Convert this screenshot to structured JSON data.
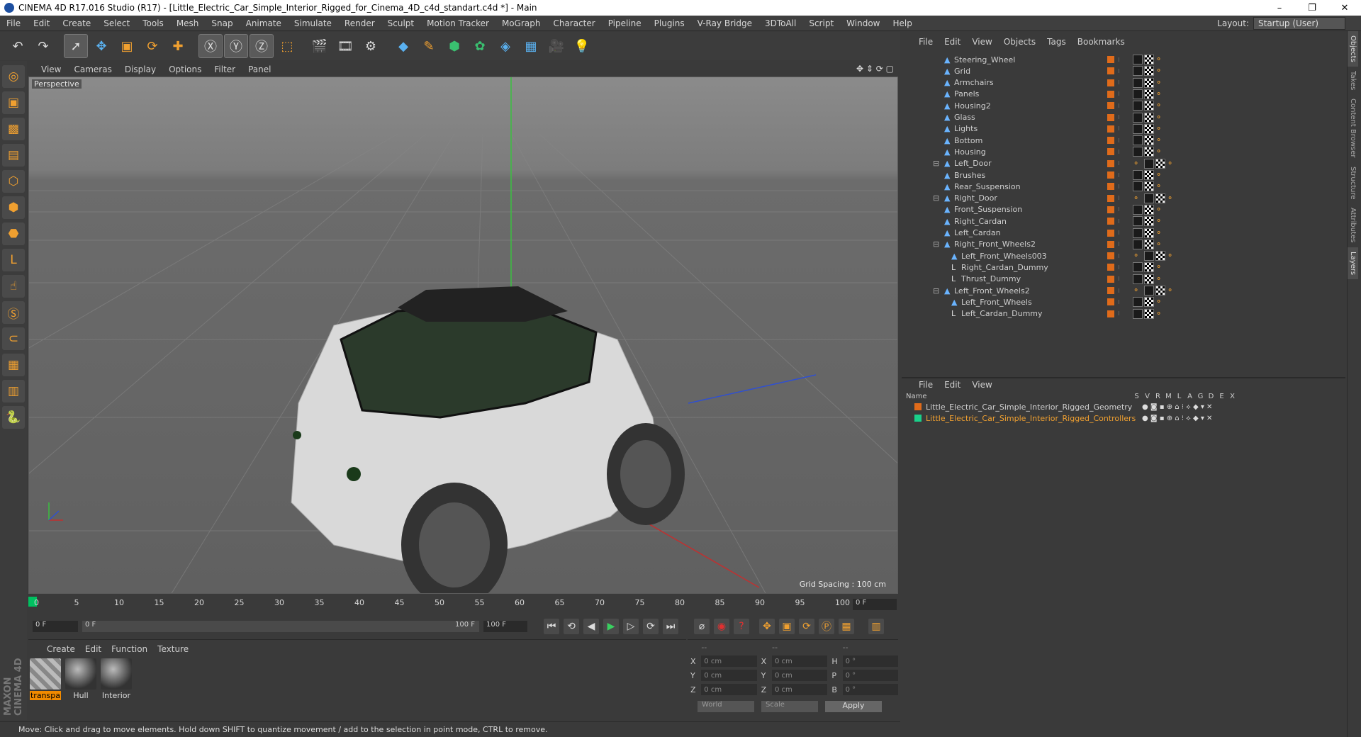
{
  "window": {
    "title": "CINEMA 4D R17.016 Studio (R17) - [Little_Electric_Car_Simple_Interior_Rigged_for_Cinema_4D_c4d_standart.c4d *] - Main",
    "controls": [
      "–",
      "❐",
      "✕"
    ]
  },
  "menubar": [
    "File",
    "Edit",
    "Create",
    "Select",
    "Tools",
    "Mesh",
    "Snap",
    "Animate",
    "Simulate",
    "Render",
    "Sculpt",
    "Motion Tracker",
    "MoGraph",
    "Character",
    "Pipeline",
    "Plugins",
    "V-Ray Bridge",
    "3DToAll",
    "Script",
    "Window",
    "Help"
  ],
  "layout": {
    "label": "Layout:",
    "value": "Startup (User)"
  },
  "viewport": {
    "menu": [
      "View",
      "Cameras",
      "Display",
      "Options",
      "Filter",
      "Panel"
    ],
    "label": "Perspective",
    "grid_spacing": "Grid Spacing : 100 cm"
  },
  "timeline": {
    "ticks": [
      "0",
      "5",
      "10",
      "15",
      "20",
      "25",
      "30",
      "35",
      "40",
      "45",
      "50",
      "55",
      "60",
      "65",
      "70",
      "75",
      "80",
      "85",
      "90",
      "95",
      "100"
    ],
    "current": "0 F"
  },
  "transport": {
    "start": "0 F",
    "range_start": "0 F",
    "range_end": "100 F",
    "end": "100 F"
  },
  "materials": {
    "menu": [
      "Create",
      "Edit",
      "Function",
      "Texture"
    ],
    "items": [
      {
        "name": "transpa",
        "highlight": true
      },
      {
        "name": "Hull",
        "highlight": false
      },
      {
        "name": "Interior",
        "highlight": false
      }
    ]
  },
  "coords": {
    "headers": [
      "--",
      "--",
      "--"
    ],
    "rows": [
      {
        "a": "X",
        "av": "0 cm",
        "b": "X",
        "bv": "0 cm",
        "c": "H",
        "cv": "0 °"
      },
      {
        "a": "Y",
        "av": "0 cm",
        "b": "Y",
        "bv": "0 cm",
        "c": "P",
        "cv": "0 °"
      },
      {
        "a": "Z",
        "av": "0 cm",
        "b": "Z",
        "bv": "0 cm",
        "c": "B",
        "cv": "0 °"
      }
    ],
    "world": "World",
    "scale": "Scale",
    "apply": "Apply"
  },
  "status": "Move: Click and drag to move elements. Hold down SHIFT to quantize movement / add to the selection in point mode, CTRL to remove.",
  "object_manager": {
    "menu": [
      "File",
      "Edit",
      "View",
      "Objects",
      "Tags",
      "Bookmarks"
    ],
    "objects": [
      {
        "name": "Steering_Wheel",
        "depth": 0
      },
      {
        "name": "Grid",
        "depth": 0
      },
      {
        "name": "Armchairs",
        "depth": 0
      },
      {
        "name": "Panels",
        "depth": 0
      },
      {
        "name": "Housing2",
        "depth": 0
      },
      {
        "name": "Glass",
        "depth": 0
      },
      {
        "name": "Lights",
        "depth": 0
      },
      {
        "name": "Bottom",
        "depth": 0
      },
      {
        "name": "Housing",
        "depth": 0
      },
      {
        "name": "Left_Door",
        "depth": 0
      },
      {
        "name": "Brushes",
        "depth": 0
      },
      {
        "name": "Rear_Suspension",
        "depth": 0
      },
      {
        "name": "Right_Door",
        "depth": 0
      },
      {
        "name": "Front_Suspension",
        "depth": 0
      },
      {
        "name": "Right_Cardan",
        "depth": 0
      },
      {
        "name": "Left_Cardan",
        "depth": 0
      },
      {
        "name": "Right_Front_Wheels2",
        "depth": 0
      },
      {
        "name": "Left_Front_Wheels003",
        "depth": 1
      },
      {
        "name": "Right_Cardan_Dummy",
        "depth": 1
      },
      {
        "name": "Thrust_Dummy",
        "depth": 1
      },
      {
        "name": "Left_Front_Wheels2",
        "depth": 0
      },
      {
        "name": "Left_Front_Wheels",
        "depth": 1
      },
      {
        "name": "Left_Cardan_Dummy",
        "depth": 1
      }
    ]
  },
  "layer_manager": {
    "menu": [
      "File",
      "Edit",
      "View"
    ],
    "header": "Name",
    "cols": [
      "S",
      "V",
      "R",
      "M",
      "L",
      "A",
      "G",
      "D",
      "E",
      "X"
    ],
    "layers": [
      {
        "name": "Little_Electric_Car_Simple_Interior_Rigged_Geometry",
        "color": "#e06b1a"
      },
      {
        "name": "Little_Electric_Car_Simple_Interior_Rigged_Controllers",
        "color": "#1ad08a"
      }
    ]
  },
  "right_tabs": [
    "Objects",
    "Takes",
    "Content Browser",
    "Structure",
    "Attributes",
    "Layers"
  ]
}
